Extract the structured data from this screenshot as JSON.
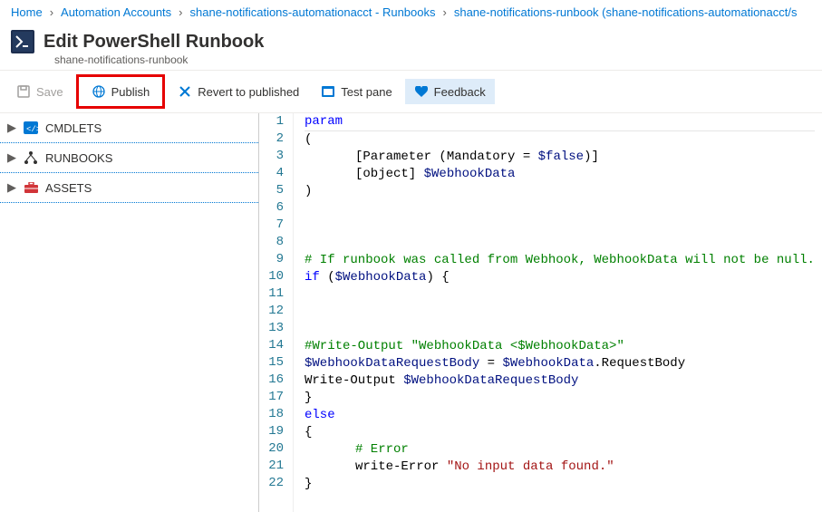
{
  "breadcrumb": {
    "items": [
      "Home",
      "Automation Accounts",
      "shane-notifications-automationacct - Runbooks",
      "shane-notifications-runbook (shane-notifications-automationacct/s"
    ]
  },
  "header": {
    "title": "Edit PowerShell Runbook",
    "subtitle": "shane-notifications-runbook"
  },
  "toolbar": {
    "save": "Save",
    "publish": "Publish",
    "revert": "Revert to published",
    "testpane": "Test pane",
    "feedback": "Feedback"
  },
  "sidebar": {
    "items": [
      {
        "label": "CMDLETS",
        "icon": "code-icon",
        "color": "#0078d4"
      },
      {
        "label": "RUNBOOKS",
        "icon": "hierarchy-icon",
        "color": "#000"
      },
      {
        "label": "ASSETS",
        "icon": "toolbox-icon",
        "color": "#d13438"
      }
    ]
  },
  "editor": {
    "lines": [
      [
        {
          "t": "kw",
          "s": "param"
        }
      ],
      [
        {
          "t": "plain",
          "s": "("
        }
      ],
      [
        {
          "t": "indent",
          "n": 2
        },
        {
          "t": "plain",
          "s": "[Parameter (Mandatory = "
        },
        {
          "t": "var",
          "s": "$false"
        },
        {
          "t": "plain",
          "s": ")]"
        }
      ],
      [
        {
          "t": "indent",
          "n": 2
        },
        {
          "t": "plain",
          "s": "[object] "
        },
        {
          "t": "var",
          "s": "$WebhookData"
        }
      ],
      [
        {
          "t": "plain",
          "s": ")"
        }
      ],
      [],
      [],
      [],
      [
        {
          "t": "cmt",
          "s": "# If runbook was called from Webhook, WebhookData will not be null."
        }
      ],
      [
        {
          "t": "kw",
          "s": "if"
        },
        {
          "t": "plain",
          "s": " ("
        },
        {
          "t": "var",
          "s": "$WebhookData"
        },
        {
          "t": "plain",
          "s": ") {"
        }
      ],
      [],
      [],
      [],
      [
        {
          "t": "cmt",
          "s": "#Write-Output \"WebhookData <$WebhookData>\""
        }
      ],
      [
        {
          "t": "var",
          "s": "$WebhookDataRequestBody"
        },
        {
          "t": "plain",
          "s": " = "
        },
        {
          "t": "var",
          "s": "$WebhookData"
        },
        {
          "t": "plain",
          "s": ".RequestBody"
        }
      ],
      [
        {
          "t": "plain",
          "s": "Write-Output "
        },
        {
          "t": "var",
          "s": "$WebhookDataRequestBody"
        }
      ],
      [
        {
          "t": "plain",
          "s": "}"
        }
      ],
      [
        {
          "t": "kw",
          "s": "else"
        }
      ],
      [
        {
          "t": "plain",
          "s": "{"
        }
      ],
      [
        {
          "t": "indent",
          "n": 2
        },
        {
          "t": "cmt",
          "s": "# Error"
        }
      ],
      [
        {
          "t": "indent",
          "n": 2
        },
        {
          "t": "plain",
          "s": "write-Error "
        },
        {
          "t": "str",
          "s": "\"No input data found.\""
        }
      ],
      [
        {
          "t": "plain",
          "s": "}"
        }
      ]
    ]
  }
}
